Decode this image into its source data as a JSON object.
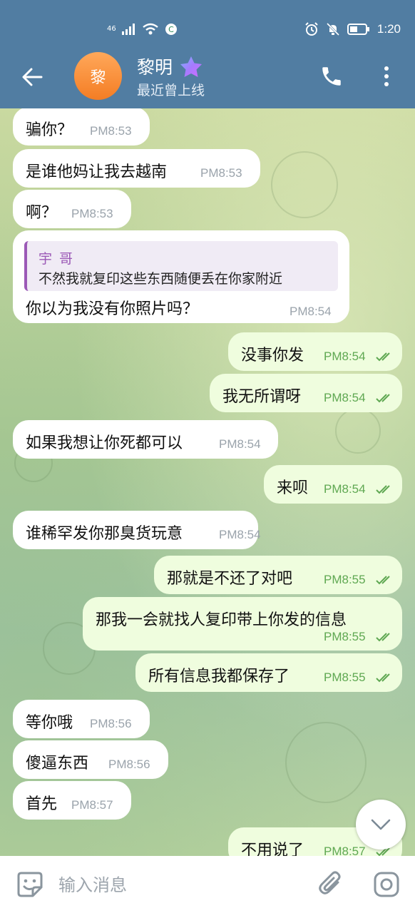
{
  "status_bar": {
    "network": "46",
    "time": "1:20",
    "icons": [
      "signal-icon",
      "wifi-icon",
      "app-icon",
      "alarm-icon",
      "mute-icon",
      "battery-icon"
    ]
  },
  "header": {
    "avatar_letter": "黎",
    "name": "黎明",
    "status": "最近曾上线",
    "icons": [
      "back-arrow-icon",
      "premium-star-icon",
      "phone-icon",
      "more-icon"
    ]
  },
  "messages": [
    {
      "dir": "in",
      "text": "骗你？",
      "time": "PM8:53"
    },
    {
      "dir": "in",
      "text": "是谁他妈让我去越南",
      "time": "PM8:53"
    },
    {
      "dir": "in",
      "text": "啊？",
      "time": "PM8:53"
    },
    {
      "dir": "in",
      "reply_name": "宇 哥",
      "reply_text": "不然我就复印这些东西随便丢在你家附近",
      "text": "你以为我没有你照片吗？",
      "time": "PM8:54"
    },
    {
      "dir": "out",
      "text": "没事你发",
      "time": "PM8:54"
    },
    {
      "dir": "out",
      "text": "我无所谓呀",
      "time": "PM8:54"
    },
    {
      "dir": "in",
      "text": "如果我想让你死都可以",
      "time": "PM8:54"
    },
    {
      "dir": "out",
      "text": "来呗",
      "time": "PM8:54"
    },
    {
      "dir": "in",
      "text": "谁稀罕发你那臭货玩意",
      "time": "PM8:54"
    },
    {
      "dir": "out",
      "text": "那就是不还了对吧",
      "time": "PM8:55"
    },
    {
      "dir": "out",
      "text": "那我一会就找人复印带上你发的信息",
      "time": "PM8:55"
    },
    {
      "dir": "out",
      "text": "所有信息我都保存了",
      "time": "PM8:55"
    },
    {
      "dir": "in",
      "text": "等你哦",
      "time": "PM8:56"
    },
    {
      "dir": "in",
      "text": "傻逼东西",
      "time": "PM8:56"
    },
    {
      "dir": "in",
      "text": "首先",
      "time": "PM8:57"
    },
    {
      "dir": "out",
      "text": "不用说了",
      "time": "PM8:57"
    }
  ],
  "input": {
    "placeholder": "输入消息"
  },
  "colors": {
    "header": "#517da2",
    "incoming": "#ffffff",
    "outgoing": "#effdde",
    "outgoing_time": "#5fa852",
    "reply_accent": "#9b59b6"
  }
}
